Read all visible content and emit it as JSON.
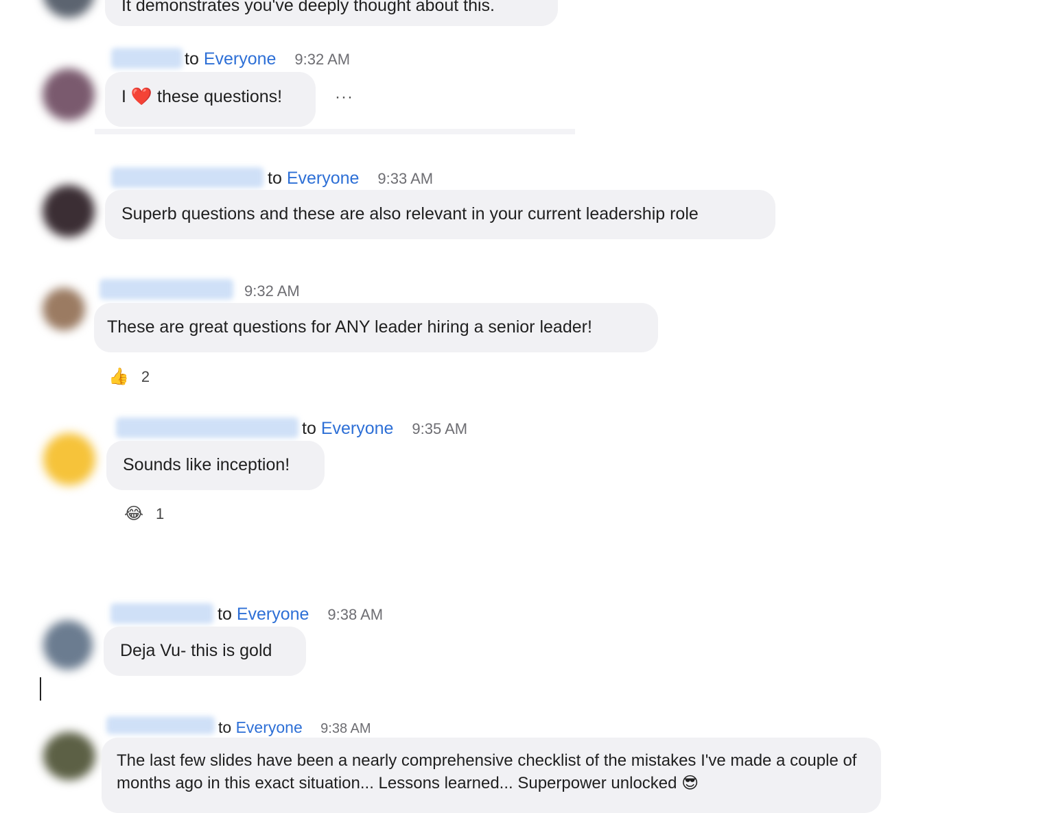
{
  "top_message": {
    "text": "It demonstrates you've deeply thought about this."
  },
  "messages": [
    {
      "to": "to",
      "recipient": "Everyone",
      "time": "9:32 AM",
      "text_prefix": "I",
      "heart": "❤️",
      "text_suffix": "these questions!",
      "more": "···"
    },
    {
      "to": "to",
      "recipient": "Everyone",
      "time": "9:33 AM",
      "text": "Superb questions and these are also relevant in your current leadership role"
    },
    {
      "time": "9:32 AM",
      "text": "These are great questions for ANY leader hiring a senior leader!",
      "reaction": {
        "emoji": "👍",
        "count": "2"
      }
    },
    {
      "to": "to",
      "recipient": "Everyone",
      "time": "9:35 AM",
      "text": "Sounds like inception!",
      "reaction": {
        "emoji": "😂",
        "count": "1"
      }
    },
    {
      "to": "to",
      "recipient": "Everyone",
      "time": "9:38 AM",
      "text": "Deja Vu- this is gold"
    },
    {
      "to": "to",
      "recipient": "Everyone",
      "time": "9:38 AM",
      "text": "The last few slides have been a nearly comprehensive checklist of the mistakes I've made a couple of months ago in this exact situation... Lessons learned... Superpower unlocked 😎"
    }
  ],
  "colors": {
    "bubble": "#f1f1f4",
    "recipient_link": "#2d6fd6",
    "timestamp": "#6d6d72"
  }
}
